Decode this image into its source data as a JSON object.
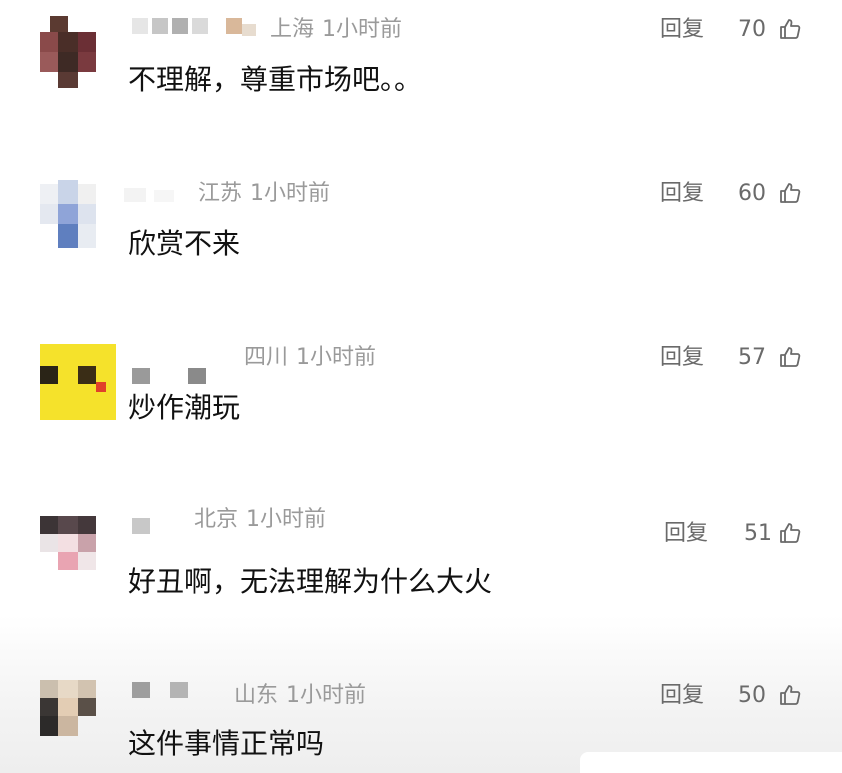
{
  "comments": [
    {
      "region": "上海",
      "time": "1小时前",
      "reply_label": "回复",
      "likes": "70",
      "text": "不理解，尊重市场吧。。"
    },
    {
      "region": "江苏",
      "time": "1小时前",
      "reply_label": "回复",
      "likes": "60",
      "text": "欣赏不来"
    },
    {
      "region": "四川",
      "time": "1小时前",
      "reply_label": "回复",
      "likes": "57",
      "text": "炒作潮玩"
    },
    {
      "region": "北京",
      "time": "1小时前",
      "reply_label": "回复",
      "likes": "51",
      "text": "好丑啊，无法理解为什么大火"
    },
    {
      "region": "山东",
      "time": "1小时前",
      "reply_label": "回复",
      "likes": "50",
      "text": "这件事情正常吗"
    }
  ],
  "colors": {
    "meta_text": "#9a9a9a",
    "body_text": "#111111",
    "action_text": "#6a6a6a"
  },
  "icons": {
    "like": "thumbs-up-outline-icon"
  }
}
